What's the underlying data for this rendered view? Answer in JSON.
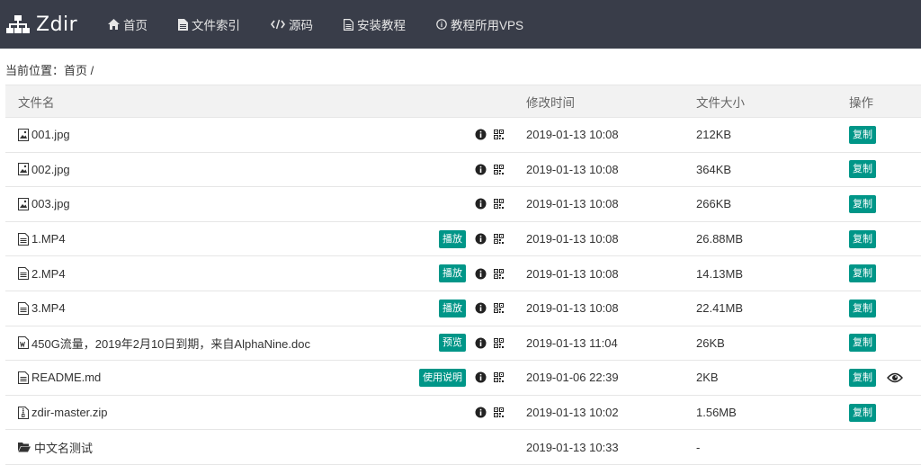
{
  "brand": {
    "name": "Zdir",
    "icon": "sitemap-icon"
  },
  "nav": [
    {
      "label": "首页",
      "icon": "home-icon"
    },
    {
      "label": "文件索引",
      "icon": "file-icon"
    },
    {
      "label": "源码",
      "icon": "code-icon"
    },
    {
      "label": "安装教程",
      "icon": "document-icon"
    },
    {
      "label": "教程所用VPS",
      "icon": "info-icon"
    }
  ],
  "breadcrumb": "当前位置：首页 /",
  "table": {
    "headers": [
      "文件名",
      "修改时间",
      "文件大小",
      "操作"
    ],
    "rows": [
      {
        "name": "001.jpg",
        "icon": "image-file-icon",
        "action": "",
        "time": "2019-01-13 10:08",
        "size": "212KB",
        "copy": "复制"
      },
      {
        "name": "002.jpg",
        "icon": "image-file-icon",
        "action": "",
        "time": "2019-01-13 10:08",
        "size": "364KB",
        "copy": "复制"
      },
      {
        "name": "003.jpg",
        "icon": "image-file-icon",
        "action": "",
        "time": "2019-01-13 10:08",
        "size": "266KB",
        "copy": "复制"
      },
      {
        "name": "1.MP4",
        "icon": "text-file-icon",
        "action": "播放",
        "time": "2019-01-13 10:08",
        "size": "26.88MB",
        "copy": "复制"
      },
      {
        "name": "2.MP4",
        "icon": "text-file-icon",
        "action": "播放",
        "time": "2019-01-13 10:08",
        "size": "14.13MB",
        "copy": "复制"
      },
      {
        "name": "3.MP4",
        "icon": "text-file-icon",
        "action": "播放",
        "time": "2019-01-13 10:08",
        "size": "22.41MB",
        "copy": "复制"
      },
      {
        "name": "450G流量，2019年2月10日到期，来自AlphaNine.doc",
        "icon": "word-file-icon",
        "action": "预览",
        "time": "2019-01-13 11:04",
        "size": "26KB",
        "copy": "复制"
      },
      {
        "name": "README.md",
        "icon": "text-file-icon",
        "action": "使用说明",
        "time": "2019-01-06 22:39",
        "size": "2KB",
        "copy": "复制",
        "eye": true
      },
      {
        "name": "zdir-master.zip",
        "icon": "zip-file-icon",
        "action": "",
        "time": "2019-01-13 10:02",
        "size": "1.56MB",
        "copy": "复制"
      },
      {
        "name": "中文名测试",
        "icon": "folder-open-icon",
        "folder": true,
        "time": "2019-01-13 10:33",
        "size": "-",
        "copy": ""
      }
    ]
  },
  "colors": {
    "navbar": "#393d49",
    "accent": "#009688",
    "header_bg": "#f2f2f2"
  }
}
